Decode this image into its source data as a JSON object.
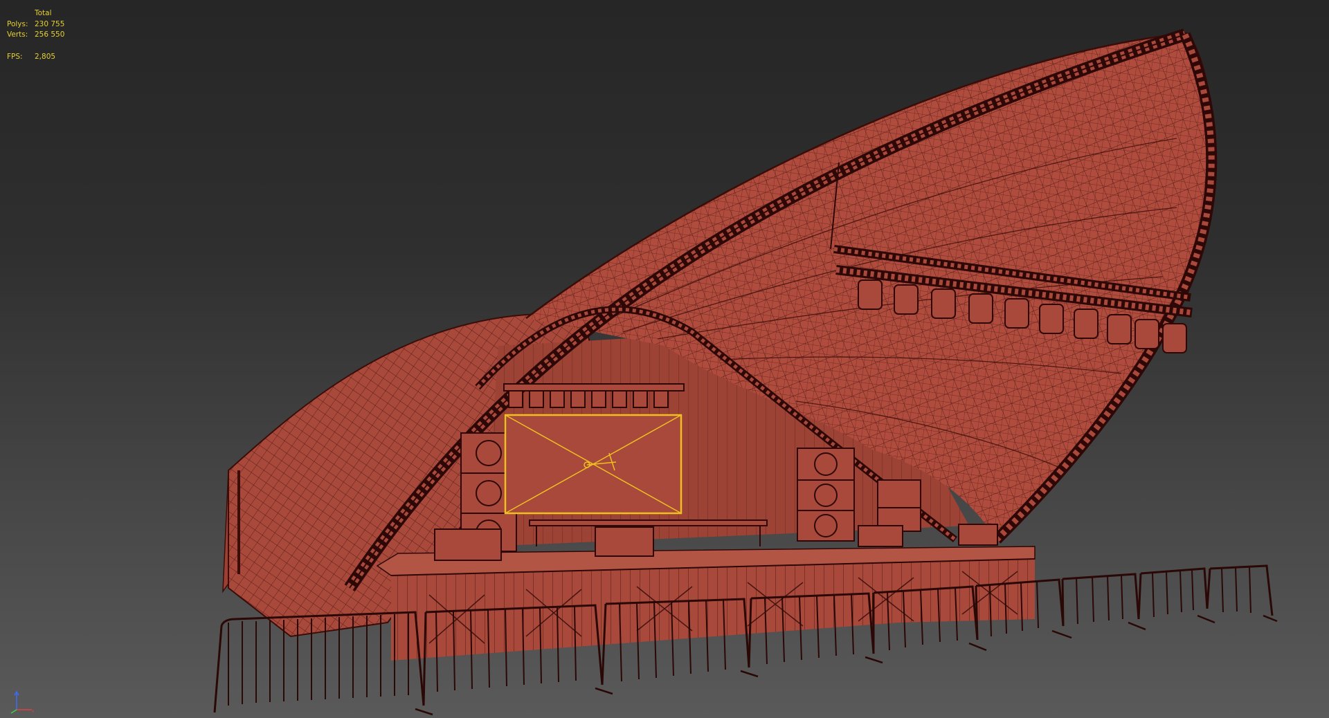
{
  "viewport": {
    "stats": {
      "header": "Total",
      "polys_label": "Polys:",
      "polys_value": "230 755",
      "verts_label": "Verts:",
      "verts_value": "256 550",
      "fps_label": "FPS:",
      "fps_value": "2,805"
    },
    "colors": {
      "mesh_fill": "#a8493b",
      "wire": "#3a0d08",
      "selection": "#f0c020",
      "stats_text": "#e6d030"
    }
  }
}
